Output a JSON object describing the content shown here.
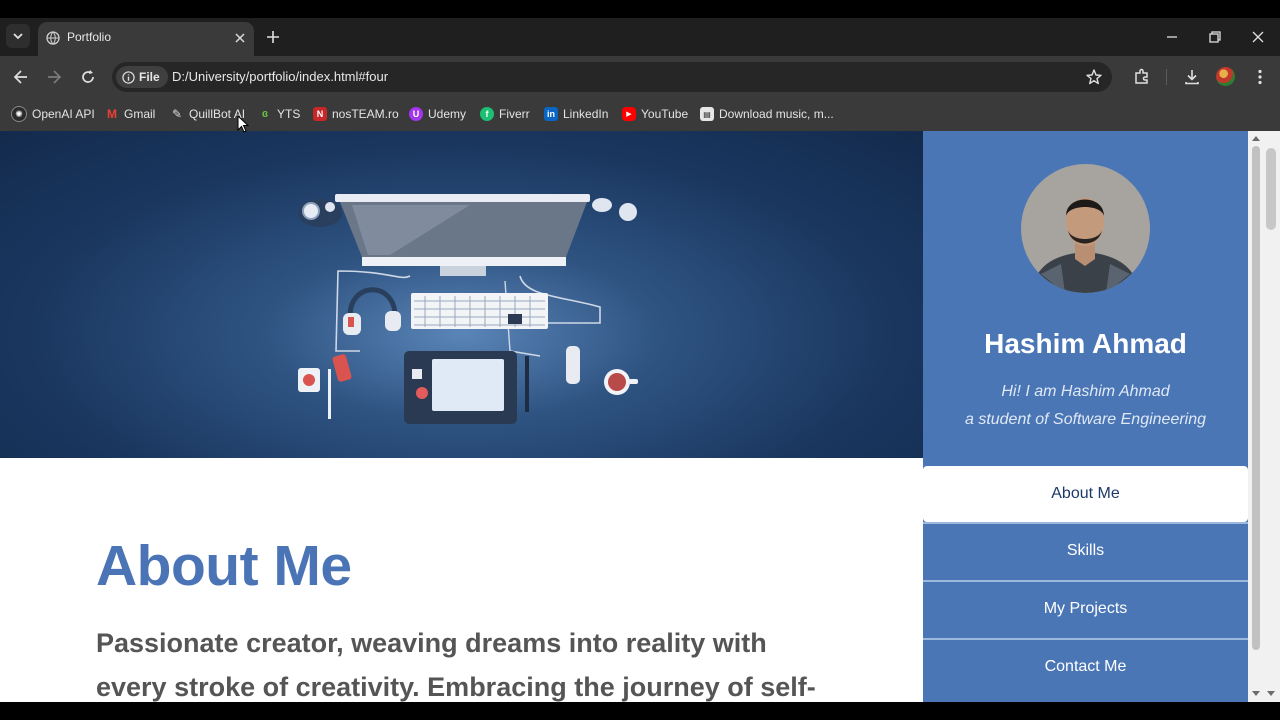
{
  "browser": {
    "tab": {
      "title": "Portfolio"
    },
    "address": {
      "chip": "File",
      "url": "D:/University/portfolio/index.html#four"
    },
    "bookmarks": [
      {
        "label": "OpenAI API",
        "icon": "openai-icon",
        "color": "#2b2b2b"
      },
      {
        "label": "Gmail",
        "icon": "gmail-icon",
        "color": "#ea4335"
      },
      {
        "label": "QuillBot AI",
        "icon": "quillbot-icon",
        "color": "#3a3a3a"
      },
      {
        "label": "YTS",
        "icon": "yts-icon",
        "color": "#6ac045"
      },
      {
        "label": "nosTEAM.ro",
        "icon": "nosteam-icon",
        "color": "#c62828"
      },
      {
        "label": "Udemy",
        "icon": "udemy-icon",
        "color": "#a435f0"
      },
      {
        "label": "Fiverr",
        "icon": "fiverr-icon",
        "color": "#1dbf73"
      },
      {
        "label": "LinkedIn",
        "icon": "linkedin-icon",
        "color": "#0a66c2"
      },
      {
        "label": "YouTube",
        "icon": "youtube-icon",
        "color": "#ff0000"
      },
      {
        "label": "Download music, m...",
        "icon": "download-site-icon",
        "color": "#e6e6e6"
      }
    ]
  },
  "page": {
    "about": {
      "title": "About Me",
      "text": "Passionate creator, weaving dreams into reality with every stroke of creativity. Embracing the journey of self-"
    },
    "profile": {
      "name": "Hashim Ahmad",
      "tagline1": "Hi! I am Hashim Ahmad",
      "tagline2": "a student of Software Engineering"
    },
    "menu": [
      {
        "label": "About Me",
        "active": true
      },
      {
        "label": "Skills",
        "active": false
      },
      {
        "label": "My Projects",
        "active": false
      },
      {
        "label": "Contact Me",
        "active": false
      }
    ]
  },
  "colors": {
    "accent": "#4a76b5",
    "heading": "#4a74b5",
    "hero_dark": "#132a4c"
  }
}
